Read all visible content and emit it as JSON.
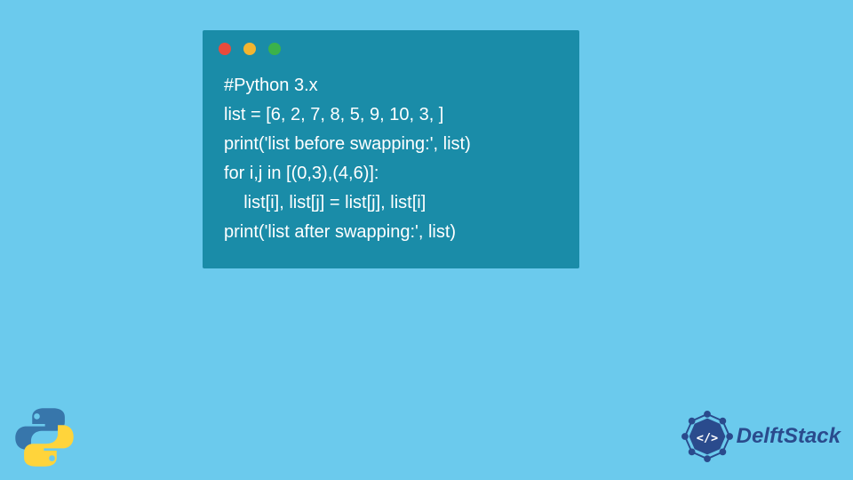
{
  "code": {
    "lines": [
      "#Python 3.x",
      "list = [6, 2, 7, 8, 5, 9, 10, 3, ]",
      "print('list before swapping:', list)",
      "for i,j in [(0,3),(4,6)]:",
      "    list[i], list[j] = list[j], list[i]",
      "print('list after swapping:', list)"
    ]
  },
  "window": {
    "controls": [
      "red",
      "yellow",
      "green"
    ]
  },
  "branding": {
    "delft_text": "DelftStack"
  },
  "colors": {
    "background": "#6bcaed",
    "code_bg": "#1a8ca8",
    "code_text": "#ffffff",
    "delft_blue": "#2a4b8d",
    "python_blue": "#3776ab",
    "python_yellow": "#ffd43b"
  }
}
